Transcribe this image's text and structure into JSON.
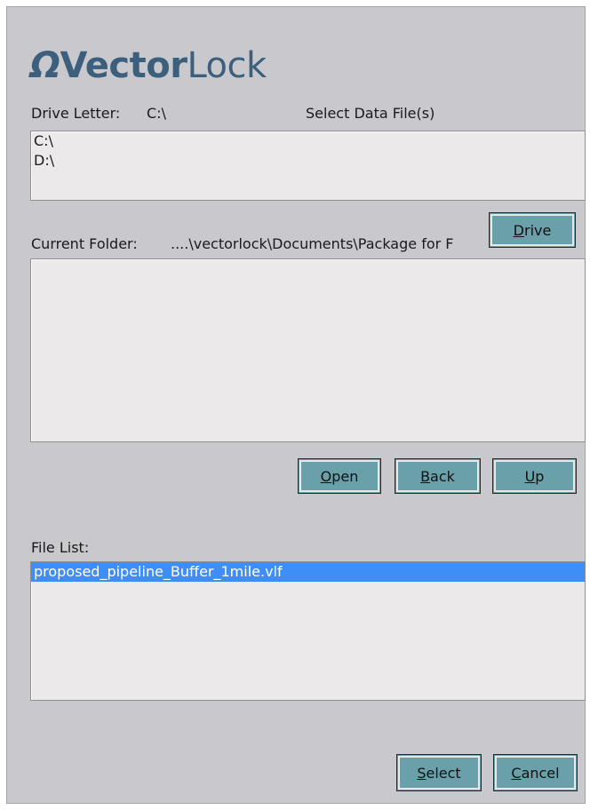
{
  "logo": {
    "mark": "Ω",
    "bold": "Vector",
    "light": "Lock"
  },
  "drive": {
    "label": "Drive Letter:",
    "value": "C:\\"
  },
  "select_data_label": "Select Data File(s)",
  "drive_list": [
    {
      "label": "C:\\"
    },
    {
      "label": "D:\\"
    }
  ],
  "current_folder": {
    "label": "Current Folder:",
    "value": "....\\vectorlock\\Documents\\Package for F"
  },
  "buttons": {
    "drive": {
      "ul": "D",
      "rest": "rive"
    },
    "open": {
      "ul": "O",
      "rest": "pen"
    },
    "back": {
      "ul": "B",
      "rest": "ack"
    },
    "up": {
      "ul": "U",
      "rest": "p"
    },
    "select": {
      "ul": "S",
      "rest": "elect"
    },
    "cancel": {
      "ul": "C",
      "rest": "ancel"
    }
  },
  "file_list": {
    "label": "File List:",
    "items": [
      {
        "label": "proposed_pipeline_Buffer_1mile.vlf",
        "selected": true
      }
    ]
  },
  "colors": {
    "button": "#6aa0aa",
    "selection": "#3f8ef8",
    "panel": "#c9c8cc",
    "logo": "#3b5f7d"
  }
}
